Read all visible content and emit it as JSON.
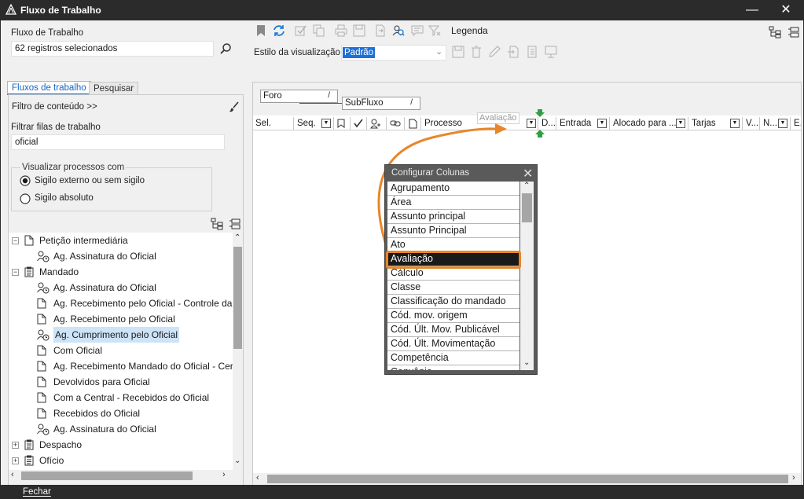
{
  "window": {
    "title": "Fluxo de Trabalho",
    "minimize": "—",
    "close": "✕"
  },
  "workflow": {
    "label": "Fluxo de Trabalho",
    "value": "62 registros selecionados"
  },
  "tabs": {
    "active": "Fluxos de trabalho",
    "inactive": "Pesquisar"
  },
  "filter": {
    "content_filter": "Filtro de conteúdo >>",
    "queues_label": "Filtrar filas de trabalho",
    "queues_value": "oficial"
  },
  "visibility": {
    "legend": "Visualizar processos com",
    "option1": "Sigilo externo ou sem sigilo",
    "option2": "Sigilo absoluto",
    "selected": "option1"
  },
  "tree": [
    {
      "level": 0,
      "expander": "−",
      "icon": "document",
      "text": "Petição intermediária"
    },
    {
      "level": 1,
      "icon": "people-clock",
      "text": "Ag. Assinatura do Oficial"
    },
    {
      "level": 0,
      "expander": "−",
      "icon": "clipboard",
      "text": "Mandado"
    },
    {
      "level": 1,
      "icon": "people-clock",
      "text": "Ag. Assinatura do Oficial"
    },
    {
      "level": 1,
      "icon": "document",
      "text": "Ag. Recebimento pelo Oficial - Controle da"
    },
    {
      "level": 1,
      "icon": "document",
      "text": "Ag. Recebimento pelo Oficial"
    },
    {
      "level": 1,
      "icon": "people-clock",
      "text": "Ag. Cumprimento pelo Oficial",
      "selected": true
    },
    {
      "level": 1,
      "icon": "document",
      "text": "Com Oficial"
    },
    {
      "level": 1,
      "icon": "document",
      "text": "Ag. Recebimento Mandado do Oficial - Cer"
    },
    {
      "level": 1,
      "icon": "document",
      "text": "Devolvidos para Oficial"
    },
    {
      "level": 1,
      "icon": "document",
      "text": "Com a Central - Recebidos do Oficial"
    },
    {
      "level": 1,
      "icon": "document",
      "text": "Recebidos do Oficial"
    },
    {
      "level": 1,
      "icon": "people-clock",
      "text": "Ag. Assinatura do Oficial"
    },
    {
      "level": 0,
      "expander": "+",
      "icon": "clipboard",
      "text": "Despacho"
    },
    {
      "level": 0,
      "expander": "+",
      "icon": "clipboard",
      "text": "Ofício"
    }
  ],
  "toolbar": {
    "legend": "Legenda",
    "view_style_label": "Estilo da visualização",
    "view_style_value": "Padrão"
  },
  "grouping": {
    "box1": "Foro",
    "box2": "SubFluxo",
    "slash": "/",
    "drag_label": "Avaliação"
  },
  "columns": [
    "Sel.",
    "Seq.",
    "Processo",
    "D...",
    "Entrada",
    "Alocado para ...",
    "Tarjas",
    "V...",
    "N...",
    "E."
  ],
  "popup": {
    "title": "Configurar Colunas",
    "items": [
      "Agrupamento",
      "Área",
      "Assunto principal",
      "Assunto Principal",
      "Ato",
      "Avaliação",
      "Cálculo",
      "Classe",
      "Classificação do mandado",
      "Cód. mov. origem",
      "Cód. Últ. Mov. Publicável",
      "Cód. Últ. Movimentação",
      "Competência",
      "Convênio"
    ],
    "selected": "Avaliação"
  },
  "footer": {
    "close": "Fechar"
  },
  "colors": {
    "accent": "#1565c0",
    "highlight": "#e8862a",
    "selection": "#cde3f7",
    "title_bar": "#2b2b2b"
  }
}
